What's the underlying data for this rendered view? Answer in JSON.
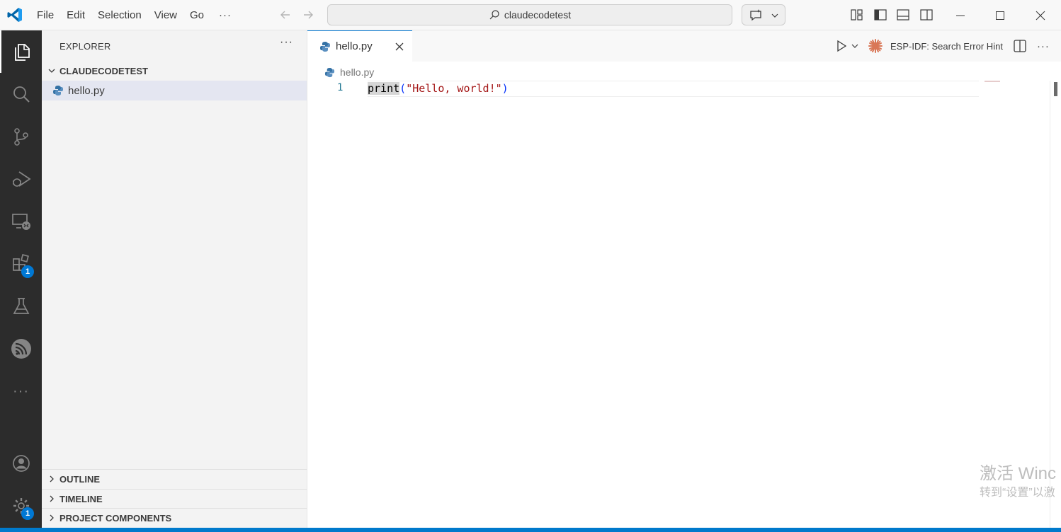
{
  "titlebar": {
    "menu": [
      "File",
      "Edit",
      "Selection",
      "View",
      "Go"
    ],
    "more": "···",
    "search_text": "claudecodetest"
  },
  "activitybar": {
    "items": [
      "explorer-icon",
      "search-icon",
      "source-control-icon",
      "run-debug-icon",
      "remote-explorer-icon",
      "extensions-icon",
      "testing-icon",
      "esp-idf-icon",
      "more-icon"
    ],
    "extensions_badge": "1",
    "more": "···",
    "manage_badge": "1"
  },
  "sidebar": {
    "title": "EXPLORER",
    "more": "···",
    "folder": "CLAUDECODETEST",
    "files": [
      "hello.py"
    ],
    "panes": [
      "OUTLINE",
      "TIMELINE",
      "PROJECT COMPONENTS"
    ]
  },
  "editor": {
    "tab": "hello.py",
    "esp_action": "ESP-IDF: Search Error Hint",
    "more": "···",
    "breadcrumb": "hello.py",
    "line_number": "1",
    "code": {
      "fn": "print",
      "open": "(",
      "str": "\"Hello, world!\"",
      "close": ")"
    }
  },
  "watermark": {
    "line1": "激活 Winc",
    "line2": "转到“设置”以激"
  },
  "colors": {
    "accent": "#0078d4",
    "statusbar": "#007acc",
    "activitybar": "#2c2c2c",
    "sidebar": "#f3f3f3"
  }
}
